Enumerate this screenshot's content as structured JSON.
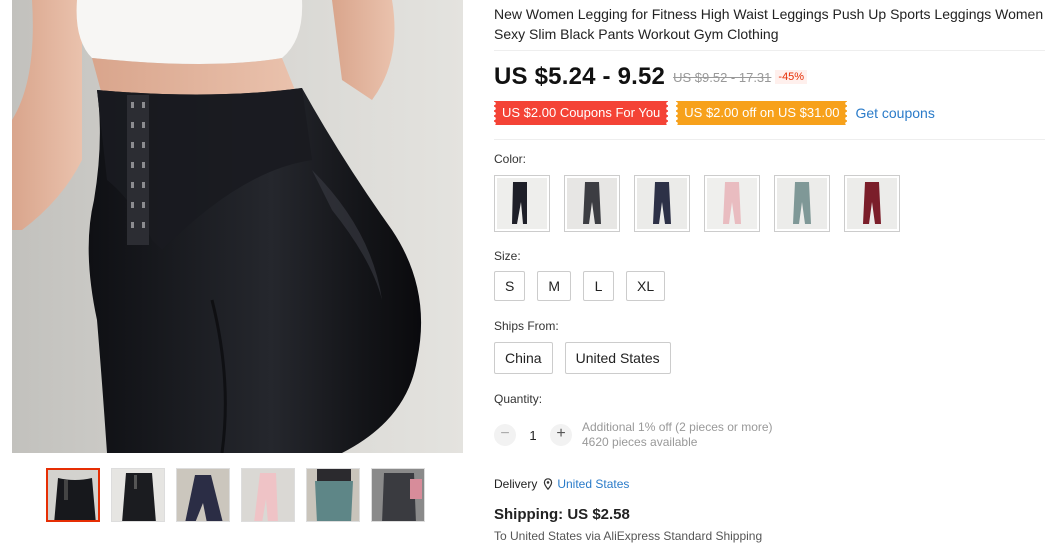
{
  "product": {
    "title": "New Women Legging for Fitness High Waist Leggings Push Up Sports Leggings Women Sexy Slim Black Pants Workout Gym Clothing"
  },
  "price": {
    "current": "US $5.24 - 9.52",
    "original": "US $9.52 - 17.31",
    "discount": "-45%"
  },
  "coupons": {
    "coupon_1": "US $2.00 Coupons For You",
    "coupon_2": "US $2.00 off on US $31.00",
    "get_coupons": "Get coupons",
    "colors": {
      "coupon_1": "#f44336",
      "coupon_2": "#f7a11b",
      "link": "#2a7bc9"
    }
  },
  "color": {
    "label": "Color:",
    "swatches": [
      {
        "name": "black",
        "hex": "#1e1f28"
      },
      {
        "name": "dark-grey",
        "hex": "#3c3d42"
      },
      {
        "name": "navy",
        "hex": "#2d3147"
      },
      {
        "name": "pink",
        "hex": "#e9bcc0"
      },
      {
        "name": "sage",
        "hex": "#7f9897"
      },
      {
        "name": "wine",
        "hex": "#7b1e2a"
      }
    ]
  },
  "size": {
    "label": "Size:",
    "options": [
      "S",
      "M",
      "L",
      "XL"
    ]
  },
  "ships_from": {
    "label": "Ships From:",
    "options": [
      "China",
      "United States"
    ]
  },
  "quantity": {
    "label": "Quantity:",
    "minus": "−",
    "value": "1",
    "plus": "+",
    "note_1": "Additional 1% off (2 pieces or more)",
    "note_2": "4620 pieces available"
  },
  "delivery": {
    "label": "Delivery",
    "icon": "location-pin-icon",
    "country": "United States"
  },
  "shipping": {
    "label": "Shipping: US $2.58",
    "note": "To United States via AliExpress Standard Shipping"
  },
  "gallery": {
    "thumbnails": 6,
    "active_index": 0,
    "active_border": "#e62e04"
  }
}
